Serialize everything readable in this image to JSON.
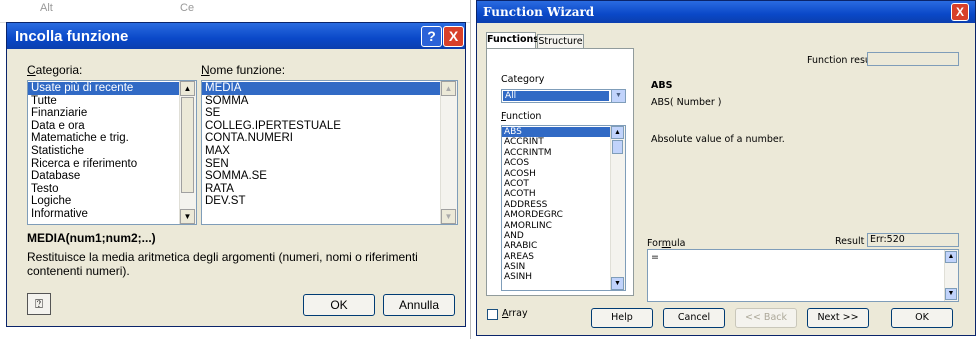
{
  "background_fragments": [
    "Alt",
    "Ce"
  ],
  "left_dialog": {
    "title": "Incolla funzione",
    "help_button": "?",
    "close_button": "X",
    "category_label": "Categoria:",
    "category_label_underline": "C",
    "category_label_rest": "ategoria:",
    "function_name_label": "Nome funzione:",
    "function_name_label_underline": "N",
    "function_name_label_rest": "ome funzione:",
    "categories": [
      "Usate più di recente",
      "Tutte",
      "Finanziarie",
      "Data e ora",
      "Matematiche e trig.",
      "Statistiche",
      "Ricerca e riferimento",
      "Database",
      "Testo",
      "Logiche",
      "Informative"
    ],
    "selected_category": "Usate più di recente",
    "functions": [
      "MEDIA",
      "SOMMA",
      "SE",
      "COLLEG.IPERTESTUALE",
      "CONTA.NUMERI",
      "MAX",
      "SEN",
      "SOMMA.SE",
      "RATA",
      "DEV.ST"
    ],
    "selected_function": "MEDIA",
    "syntax": "MEDIA(num1;num2;...)",
    "description": "Restituisce la media aritmetica degli argomenti (numeri, nomi o riferimenti contenenti numeri).",
    "ok_button": "OK",
    "cancel_button": "Annulla",
    "office_assistant_icon": "question-mark-assistant-icon"
  },
  "right_dialog": {
    "title": "Function Wizard",
    "close_button": "X",
    "tabs": [
      "Functions",
      "Structure"
    ],
    "active_tab": "Functions",
    "category_label": "Category",
    "category_value": "All",
    "function_label": "Function",
    "function_label_underline": "F",
    "function_label_rest": "unction",
    "functions": [
      "ABS",
      "ACCRINT",
      "ACCRINTM",
      "ACOS",
      "ACOSH",
      "ACOT",
      "ACOTH",
      "ADDRESS",
      "AMORDEGRC",
      "AMORLINC",
      "AND",
      "ARABIC",
      "AREAS",
      "ASIN",
      "ASINH"
    ],
    "selected_function": "ABS",
    "function_result_label": "Function result",
    "function_result_value": "",
    "func_name": "ABS",
    "func_syntax": "ABS( Number )",
    "func_description": "Absolute value of a number.",
    "formula_label": "Formula",
    "formula_label_pre": "For",
    "formula_label_underline": "m",
    "formula_label_post": "ula",
    "result_label": "Result",
    "result_value": "Err:520",
    "formula_value": "=",
    "array_label": "Array",
    "array_label_underline": "A",
    "array_label_rest": "rray",
    "array_checked": false,
    "buttons": {
      "help": "Help",
      "cancel": "Cancel",
      "back": "<< Back",
      "next": "Next >>",
      "ok": "OK"
    }
  },
  "colors": {
    "title_bar": "#0a48c8",
    "selection": "#316ac5",
    "dialog_bg": "#ece9d8",
    "close_red": "#d8402a"
  }
}
